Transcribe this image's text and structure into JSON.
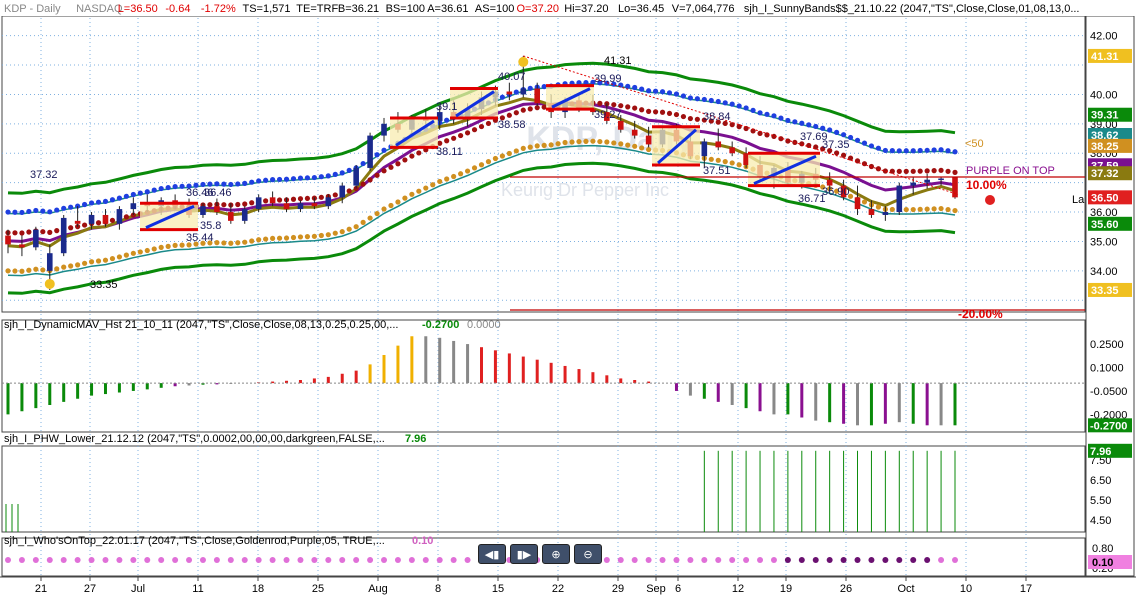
{
  "header": {
    "symbol": "KDP - Daily",
    "exchange": "NASDAQ",
    "last": "L=36.50",
    "change": "-0.64",
    "change_pct": "-1.72%",
    "ts": "TS=1,571",
    "te": "TE=TRF",
    "bid": "B=36.21",
    "bs": "BS=100",
    "ask": "A=36.61",
    "as": "AS=100",
    "open": "O=37.20",
    "high": "Hi=37.20",
    "low": "Lo=36.45",
    "volume": "V=7,064,776",
    "study": "sjh_I_SunnyBands$$_21.10.22 (2047,\"TS\",Close,Close,01,08,13,0..."
  },
  "watermark": {
    "ticker": "KDP, Daily",
    "company": "Keurig Dr Pepper Inc"
  },
  "colors": {
    "up": "#1b2a8c",
    "down": "#cc1010",
    "gold": "#f0b000",
    "blue_dots": "#1f3fe0",
    "red_dots": "#a01010",
    "orange_dots": "#d09020",
    "green_band": "#0a8a0a",
    "teal_band": "#1a8a8a",
    "olive_band": "#8a7a10",
    "purple_band": "#7a1090"
  },
  "annotations": {
    "high_label": "41.31",
    "low_label": "33.35",
    "mid_labels": [
      "37.32",
      "36.46",
      "36.46",
      "35.44",
      "35.8",
      "40.07",
      "39.99",
      "39.27",
      "39.1",
      "38.58",
      "38.11",
      "37.51",
      "38.84",
      "37.69",
      "37.35",
      "36.90",
      "36.71"
    ],
    "purple_on_top": "PURPLE ON TOP",
    "pct_up": "10.00%",
    "pct_down": "-20.00%",
    "less50": "<50",
    "l_label": "La"
  },
  "price_axis": {
    "ticks": [
      "42.00",
      "40.00",
      "39.00",
      "38.00",
      "36.00",
      "35.00",
      "34.00"
    ],
    "markers": [
      {
        "text": "41.31",
        "bg": "#f0c020",
        "fg": "#ffffff"
      },
      {
        "text": "39.31",
        "bg": "#0a8a0a",
        "fg": "#ffffff"
      },
      {
        "text": "38.62",
        "bg": "#1a8a8a",
        "fg": "#ffffff"
      },
      {
        "text": "38.25",
        "bg": "#d09020",
        "fg": "#ffffff"
      },
      {
        "text": "37.59",
        "bg": "#7a1090",
        "fg": "#ffffff"
      },
      {
        "text": "37.32",
        "bg": "#8a7a10",
        "fg": "#ffffff"
      },
      {
        "text": "36.50",
        "bg": "#e02020",
        "fg": "#ffffff"
      },
      {
        "text": "35.60",
        "bg": "#0a8a0a",
        "fg": "#ffffff"
      },
      {
        "text": "33.35",
        "bg": "#f0c020",
        "fg": "#ffffff"
      }
    ]
  },
  "panel2": {
    "title": "sjh_I_DynamicMAV_Hst 21_10_11 (2047,\"TS\",Close,Close,08,13,0.25,0.25,00,...",
    "v1": "-0.2700",
    "v2": "0.0000",
    "ticks": [
      "0.2500",
      "0.1000",
      "-0.0500",
      "-0.2000"
    ],
    "marker": "-0.2700"
  },
  "panel3": {
    "title": "sjh_I_PHW_Lower_21.12.12 (2047,\"TS\",0.0002,00,00,00,darkgreen,FALSE,...",
    "v1": "7.96",
    "ticks": [
      "7.50",
      "6.50",
      "5.50",
      "4.50"
    ],
    "marker": "7.96"
  },
  "panel4": {
    "title": "sjh_I_Who'sOnTop_22.01.17 (2047,\"TS\",Close,Goldenrod,Purple,05, TRUE,...",
    "v1": "0.10",
    "ticks": [
      "0.80",
      "0.20"
    ],
    "marker": "0.10"
  },
  "date_axis": [
    "21",
    "27",
    "Jul",
    "11",
    "18",
    "25",
    "Aug",
    "8",
    "15",
    "22",
    "29",
    "Sep",
    "6",
    "12",
    "19",
    "26",
    "Oct",
    "10",
    "17"
  ],
  "controls": [
    {
      "name": "scroll-left-button",
      "icon": "◀▮"
    },
    {
      "name": "scroll-right-button",
      "icon": "▮▶"
    },
    {
      "name": "zoom-in-button",
      "icon": "⊕"
    },
    {
      "name": "zoom-out-button",
      "icon": "⊖"
    }
  ],
  "chart_data": {
    "type": "candlestick",
    "title": "KDP - Daily NASDAQ",
    "ylim": [
      32.6,
      42.6
    ],
    "candles": [
      [
        35.2,
        35.4,
        34.6,
        34.9
      ],
      [
        34.9,
        35.2,
        34.5,
        34.8
      ],
      [
        34.8,
        35.5,
        34.7,
        35.4
      ],
      [
        34.0,
        34.9,
        33.35,
        34.6
      ],
      [
        34.6,
        35.9,
        34.5,
        35.8
      ],
      [
        35.7,
        36.2,
        35.5,
        35.6
      ],
      [
        35.6,
        36.0,
        35.4,
        35.9
      ],
      [
        35.9,
        36.1,
        35.5,
        35.6
      ],
      [
        35.6,
        36.2,
        35.4,
        36.1
      ],
      [
        36.1,
        36.5,
        35.9,
        36.3
      ],
      [
        36.3,
        36.6,
        36.0,
        36.2
      ],
      [
        36.2,
        36.5,
        35.9,
        36.4
      ],
      [
        36.4,
        36.6,
        36.1,
        36.2
      ],
      [
        36.2,
        36.46,
        35.8,
        35.9
      ],
      [
        35.9,
        36.3,
        35.8,
        36.2
      ],
      [
        36.2,
        36.46,
        35.9,
        36.0
      ],
      [
        36.0,
        36.3,
        35.6,
        35.7
      ],
      [
        35.7,
        36.2,
        35.6,
        36.1
      ],
      [
        36.1,
        36.6,
        36.0,
        36.5
      ],
      [
        36.5,
        36.7,
        36.2,
        36.3
      ],
      [
        36.3,
        36.5,
        36.0,
        36.1
      ],
      [
        36.1,
        36.4,
        36.0,
        36.3
      ],
      [
        36.3,
        36.5,
        36.1,
        36.2
      ],
      [
        36.2,
        36.6,
        36.1,
        36.5
      ],
      [
        36.5,
        37.0,
        36.3,
        36.9
      ],
      [
        36.9,
        37.6,
        36.8,
        37.5
      ],
      [
        37.5,
        38.7,
        37.4,
        38.6
      ],
      [
        38.6,
        39.2,
        38.4,
        39.0
      ],
      [
        39.0,
        39.4,
        38.7,
        38.8
      ],
      [
        38.8,
        39.3,
        38.6,
        39.2
      ],
      [
        39.2,
        39.5,
        38.9,
        39.1
      ],
      [
        39.1,
        39.6,
        38.8,
        39.4
      ],
      [
        39.4,
        39.8,
        39.0,
        39.2
      ],
      [
        39.2,
        39.7,
        38.9,
        39.5
      ],
      [
        39.5,
        40.1,
        39.3,
        39.9
      ],
      [
        39.9,
        40.3,
        39.6,
        40.1
      ],
      [
        40.1,
        40.4,
        39.8,
        40.0
      ],
      [
        40.0,
        41.31,
        39.9,
        40.2
      ],
      [
        40.2,
        40.4,
        39.6,
        39.7
      ],
      [
        39.7,
        40.0,
        39.2,
        39.4
      ],
      [
        39.4,
        39.9,
        39.2,
        39.8
      ],
      [
        39.8,
        40.0,
        39.4,
        39.5
      ],
      [
        39.5,
        39.99,
        39.3,
        39.4
      ],
      [
        39.4,
        39.7,
        39.0,
        39.1
      ],
      [
        39.1,
        39.3,
        38.7,
        38.8
      ],
      [
        38.8,
        39.1,
        38.5,
        38.6
      ],
      [
        38.6,
        38.9,
        38.2,
        38.3
      ],
      [
        38.3,
        38.9,
        38.2,
        38.8
      ],
      [
        38.8,
        39.0,
        38.3,
        38.4
      ],
      [
        38.4,
        38.6,
        37.8,
        37.9
      ],
      [
        37.9,
        38.5,
        37.51,
        38.4
      ],
      [
        38.4,
        38.84,
        38.1,
        38.2
      ],
      [
        38.2,
        38.4,
        37.9,
        38.0
      ],
      [
        38.0,
        38.2,
        37.5,
        37.6
      ],
      [
        37.6,
        37.9,
        37.0,
        37.2
      ],
      [
        37.2,
        37.6,
        36.8,
        37.5
      ],
      [
        37.5,
        37.7,
        36.9,
        37.0
      ],
      [
        37.0,
        37.4,
        36.8,
        37.3
      ],
      [
        37.3,
        37.5,
        36.9,
        37.1
      ],
      [
        37.1,
        37.35,
        36.71,
        36.9
      ],
      [
        36.9,
        37.1,
        36.4,
        36.5
      ],
      [
        36.5,
        36.9,
        35.9,
        36.1
      ],
      [
        36.1,
        36.4,
        35.8,
        35.9
      ],
      [
        35.9,
        36.2,
        35.7,
        36.0
      ],
      [
        36.0,
        37.0,
        35.9,
        36.9
      ],
      [
        36.9,
        37.2,
        36.6,
        37.0
      ],
      [
        37.0,
        37.3,
        36.8,
        37.1
      ],
      [
        37.1,
        37.2,
        36.9,
        37.14
      ],
      [
        37.2,
        37.2,
        36.45,
        36.5
      ]
    ]
  }
}
